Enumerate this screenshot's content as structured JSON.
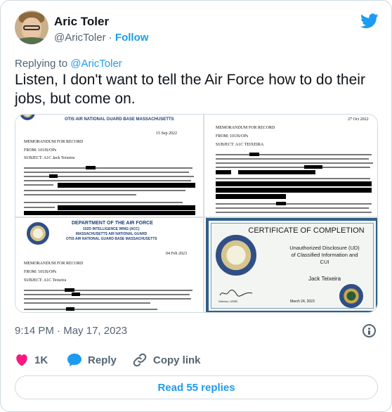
{
  "author": {
    "name": "Aric Toler",
    "handle": "@AricToler",
    "separator": "·",
    "follow_label": "Follow"
  },
  "reply_context": {
    "prefix": "Replying to ",
    "target": "@AricToler"
  },
  "tweet": {
    "text": "Listen, I don't want to tell the Air Force how to do their jobs, but come on."
  },
  "media": {
    "doc1": {
      "header": "OTIS AIR NATIONAL GUARD BASE MASSACHUSETTS",
      "date": "15 Sep 2022",
      "title": "MEMORANDUM FOR RECORD",
      "from": "FROM: 101IS/OPs",
      "subject": "SUBJECT: A1C Jack Teixeira"
    },
    "doc2": {
      "date": "27 Oct 2022",
      "title": "MEMORANDUM FOR RECORD",
      "from": "FROM: 101IS/OPs",
      "subject": "SUBJECT: A1C TEIXEIRA"
    },
    "doc3": {
      "header1": "DEPARTMENT OF THE AIR FORCE",
      "header2": "102D INTELLIGENCE WING (ACC)",
      "header3": "MASSACHUSETTS AIR NATIONAL GUARD",
      "header4": "OTIS AIR NATIONAL GUARD BASE MASSACHUSETTS",
      "date": "04 Feb 2023",
      "title": "MEMORANDUM FOR RECORD",
      "from": "FROM: 101IS/OPs",
      "subject": "SUBJECT: A1C Teixeira"
    },
    "cert": {
      "title": "CERTIFICATE OF COMPLETION",
      "course1": "Unauthorized Disclosure (UD)",
      "course2": "of Classified Information and",
      "course3": "CUI",
      "recipient": "Jack Teixeira",
      "signer_title": "Director, USSB",
      "date": "March 24, 2023"
    }
  },
  "meta": {
    "time": "9:14 PM",
    "separator": "·",
    "date": "May 17, 2023"
  },
  "actions": {
    "like_count": "1K",
    "reply_label": "Reply",
    "copy_label": "Copy link"
  },
  "read_replies_label": "Read 55 replies",
  "colors": {
    "accent": "#1d9bf0",
    "like": "#f91880",
    "text": "#0f1419",
    "secondary": "#536471",
    "border": "#cfd9de"
  }
}
